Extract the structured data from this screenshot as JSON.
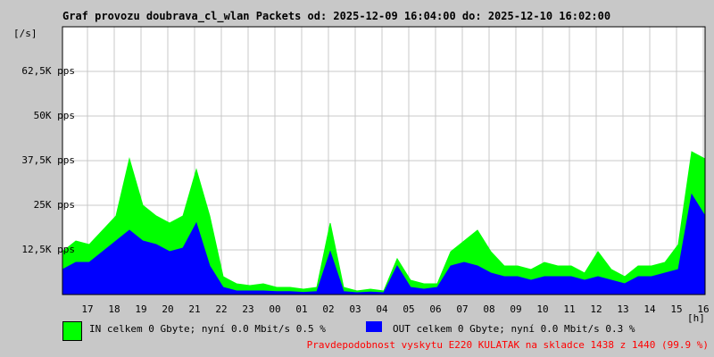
{
  "chart_data": {
    "type": "area",
    "title": "Graf provozu doubrava_cl_wlan Packets od: 2025-12-09 16:04:00 do: 2025-12-10 16:02:00",
    "ylabel": "[/s]",
    "xlabel": "[h]",
    "ylim": [
      0,
      75
    ],
    "y_ticks": [
      {
        "v": 12.5,
        "label": "12,5K pps"
      },
      {
        "v": 25,
        "label": "25K pps"
      },
      {
        "v": 37.5,
        "label": "37,5K pps"
      },
      {
        "v": 50,
        "label": "50K pps"
      },
      {
        "v": 62.5,
        "label": "62,5K pps"
      }
    ],
    "x_ticks": [
      "17",
      "18",
      "19",
      "20",
      "21",
      "22",
      "23",
      "00",
      "01",
      "02",
      "03",
      "04",
      "05",
      "06",
      "07",
      "08",
      "09",
      "10",
      "11",
      "12",
      "13",
      "14",
      "15",
      "16"
    ],
    "grid": true,
    "x_start_hour": 16.067,
    "x_step_hours": 0.5,
    "series": [
      {
        "name": "IN",
        "color": "#00ff00",
        "values_kpps": [
          12,
          15,
          14,
          18,
          22,
          38,
          25,
          22,
          20,
          22,
          35,
          22,
          5,
          3,
          2.5,
          3,
          2,
          2,
          1.5,
          2,
          20,
          2,
          1,
          1.5,
          1,
          10,
          4,
          3,
          3,
          12,
          15,
          18,
          12,
          8,
          8,
          7,
          9,
          8,
          8,
          6,
          12,
          7,
          5,
          8,
          8,
          9,
          14,
          40,
          38
        ]
      },
      {
        "name": "OUT",
        "color": "#0000ff",
        "values_kpps": [
          7,
          9,
          9,
          12,
          15,
          18,
          15,
          14,
          12,
          13,
          20,
          8,
          2,
          1,
          1,
          1,
          0.8,
          0.8,
          0.6,
          0.8,
          12,
          0.8,
          0.5,
          0.7,
          0.5,
          8,
          2,
          1.5,
          2,
          8,
          9,
          8,
          6,
          5,
          5,
          4,
          5,
          5,
          5,
          4,
          5,
          4,
          3,
          5,
          5,
          6,
          7,
          28,
          22
        ]
      }
    ],
    "legend": [
      {
        "label": "IN celkem 0 Gbyte; nyní    0.0 Mbit/s 0.5 %",
        "color": "#00ff00"
      },
      {
        "label": "OUT celkem 0 Gbyte; nyní    0.0 Mbit/s 0.3 %",
        "color": "#0000ff"
      }
    ],
    "note": "Pravdepodobnost vyskytu E220 KULATAK na skladce 1438 z 1440 (99.9 %)"
  }
}
